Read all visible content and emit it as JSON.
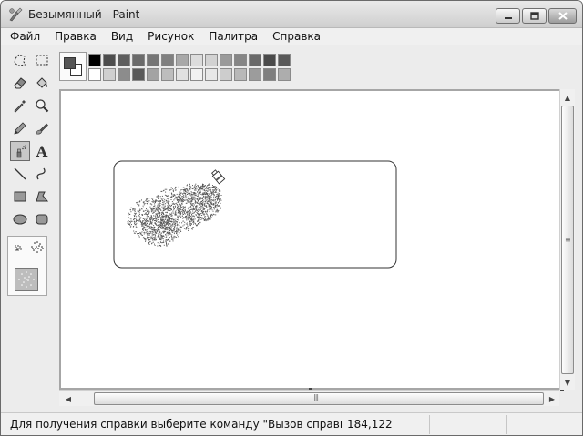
{
  "window": {
    "title": "Безымянный - Paint"
  },
  "menu": [
    "Файл",
    "Правка",
    "Вид",
    "Рисунок",
    "Палитра",
    "Справка"
  ],
  "tools": [
    {
      "name": "free-select-icon",
      "active": false
    },
    {
      "name": "rect-select-icon",
      "active": false
    },
    {
      "name": "eraser-icon",
      "active": false
    },
    {
      "name": "fill-icon",
      "active": false
    },
    {
      "name": "color-picker-icon",
      "active": false
    },
    {
      "name": "magnifier-icon",
      "active": false
    },
    {
      "name": "pencil-icon",
      "active": false
    },
    {
      "name": "brush-icon",
      "active": false
    },
    {
      "name": "airbrush-icon",
      "active": true
    },
    {
      "name": "text-icon",
      "active": false
    },
    {
      "name": "line-icon",
      "active": false
    },
    {
      "name": "curve-icon",
      "active": false
    },
    {
      "name": "rectangle-icon",
      "active": false
    },
    {
      "name": "polygon-icon",
      "active": false
    },
    {
      "name": "ellipse-icon",
      "active": false
    },
    {
      "name": "rounded-rect-icon",
      "active": false
    }
  ],
  "text_tool_glyph": "A",
  "palette": {
    "foreground": "#555555",
    "background": "#ffffff",
    "top_row": [
      "#000000",
      "#4d4d4d",
      "#5e5e5e",
      "#6b6b6b",
      "#767676",
      "#808080",
      "#a8a8a8",
      "#dcdcdc",
      "#d2d2d2",
      "#9a9a9a",
      "#868686",
      "#6a6a6a",
      "#4a4a4a",
      "#595959"
    ],
    "bottom_row": [
      "#ffffff",
      "#cfcfcf",
      "#8c8c8c",
      "#5a5a5a",
      "#a3a3a3",
      "#bdbdbd",
      "#e1e1e1",
      "#f2f2f2",
      "#e8e8e8",
      "#cdcdcd",
      "#b8b8b8",
      "#9c9c9c",
      "#7f7f7f",
      "#adadad"
    ]
  },
  "status": {
    "help_text": "Для получения справки выберите команду \"Вызов справки\" из меню \"Справка\".",
    "coords": "184,122"
  }
}
